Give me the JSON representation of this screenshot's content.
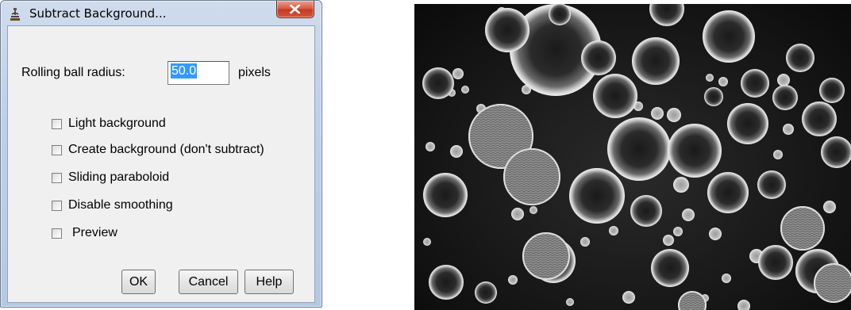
{
  "window": {
    "title": "Subtract Background...",
    "close_glyph": "X",
    "icon": "microscope-icon"
  },
  "radius": {
    "label": "Rolling ball radius:",
    "value": "50.0",
    "unit": "pixels"
  },
  "options": [
    {
      "label": "Light background",
      "checked": false
    },
    {
      "label": "Create background (don't subtract)",
      "checked": false
    },
    {
      "label": "Sliding paraboloid",
      "checked": false
    },
    {
      "label": "Disable smoothing",
      "checked": false
    },
    {
      "label": "Preview",
      "checked": false
    }
  ],
  "buttons": {
    "ok": "OK",
    "cancel": "Cancel",
    "help": "Help"
  },
  "colors": {
    "selection": "#3399ff",
    "close_button": "#c94a33",
    "dialog_face": "#f0f0f0"
  }
}
